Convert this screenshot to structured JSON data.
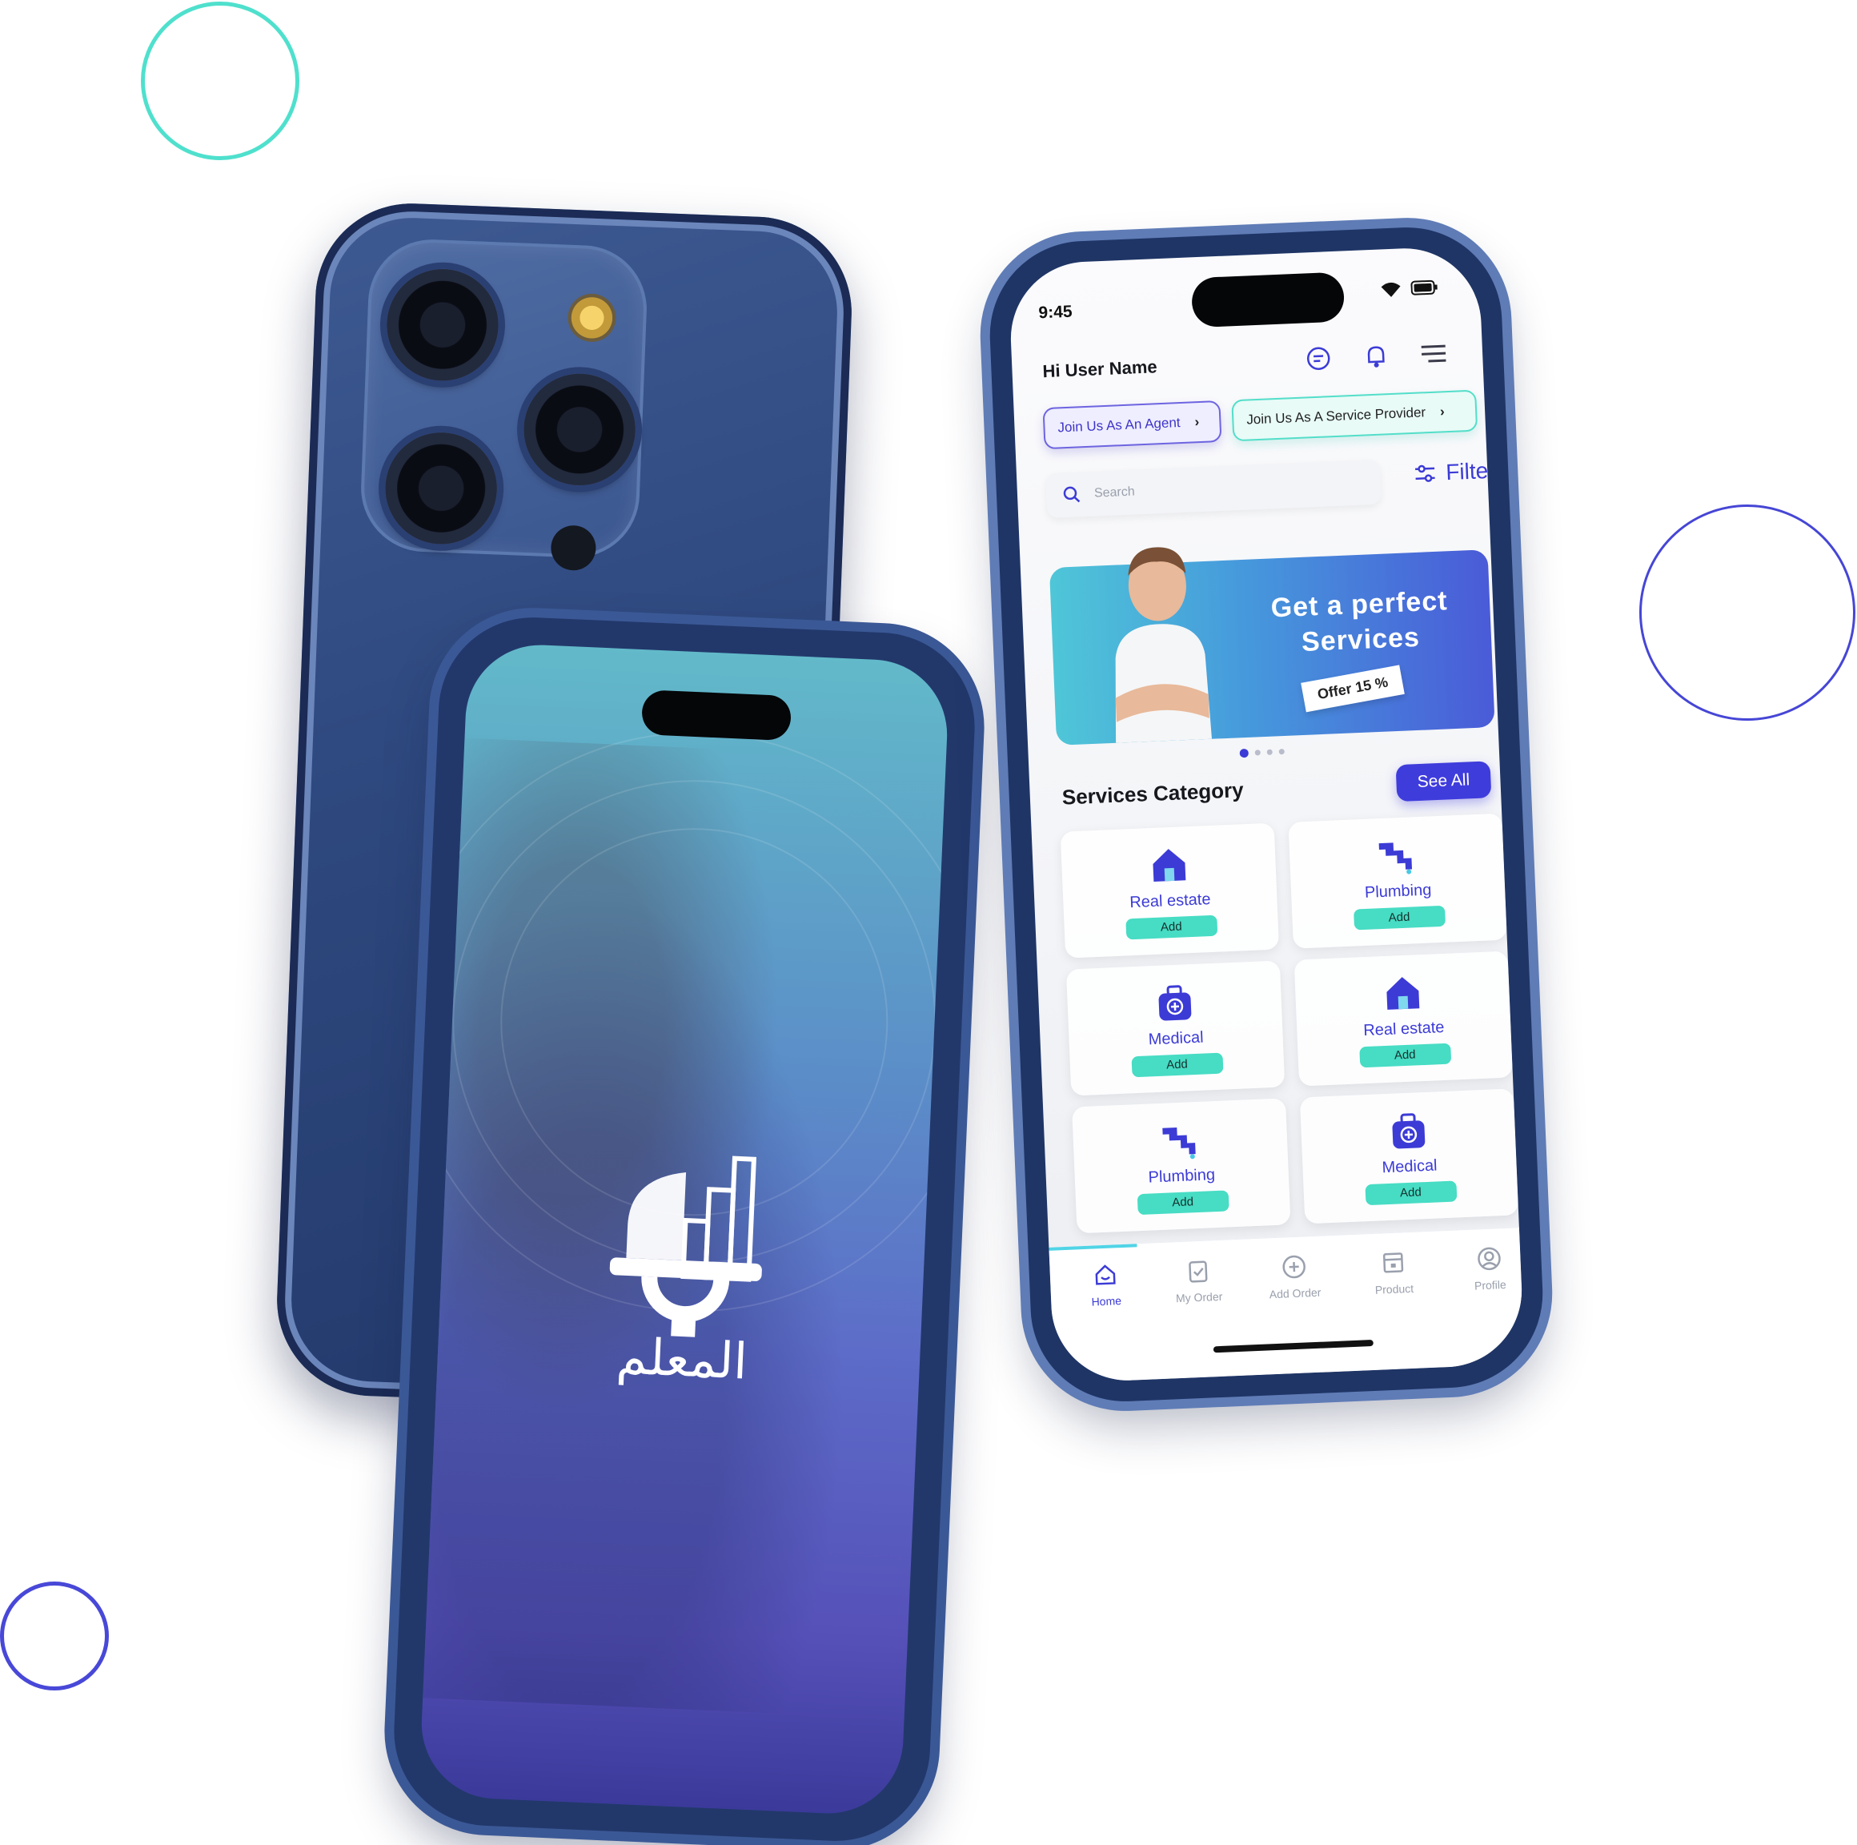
{
  "colors": {
    "accent": "#3c3bd6",
    "teal": "#47dcc4",
    "ring_teal": "#4fe0cd",
    "ring_blue": "#4646d6",
    "banner_start": "#4fc6d8",
    "banner_end": "#4a5bd8"
  },
  "splash_phone": {
    "logo_icon": "helmet-gear-buildings-icon",
    "logo_text": "المعلم"
  },
  "app": {
    "status_bar": {
      "time": "9:45",
      "icons": [
        "wifi-icon",
        "battery-icon"
      ]
    },
    "header": {
      "greeting": "Hi User Name",
      "icons": [
        "chat-icon",
        "bell-icon",
        "menu-icon"
      ]
    },
    "join_buttons": {
      "agent_label": "Join Us As An Agent",
      "provider_label": "Join Us As A Service Provider"
    },
    "search": {
      "placeholder": "Search"
    },
    "filter_label": "Filter",
    "banner": {
      "title": "Get a perfect Services",
      "offer": "Offer 15 %",
      "active_slide": 1,
      "slide_count": 4
    },
    "services": {
      "section_title": "Services Category",
      "see_all_label": "See All",
      "items": [
        {
          "label": "Real estate",
          "action": "Add",
          "icon": "house-icon"
        },
        {
          "label": "Plumbing",
          "action": "Add",
          "icon": "pipe-icon"
        },
        {
          "label": "Medical",
          "action": "Add",
          "icon": "medical-kit-icon"
        },
        {
          "label": "Real estate",
          "action": "Add",
          "icon": "house-icon"
        },
        {
          "label": "Plumbing",
          "action": "Add",
          "icon": "pipe-icon"
        },
        {
          "label": "Medical",
          "action": "Add",
          "icon": "medical-kit-icon"
        }
      ]
    },
    "tabs": [
      {
        "label": "Home",
        "icon": "home-icon",
        "active": true
      },
      {
        "label": "My Order",
        "icon": "clipboard-icon",
        "active": false
      },
      {
        "label": "Add Order",
        "icon": "plus-circle-icon",
        "active": false
      },
      {
        "label": "Product",
        "icon": "box-icon",
        "active": false
      },
      {
        "label": "Profile",
        "icon": "user-circle-icon",
        "active": false
      }
    ]
  }
}
